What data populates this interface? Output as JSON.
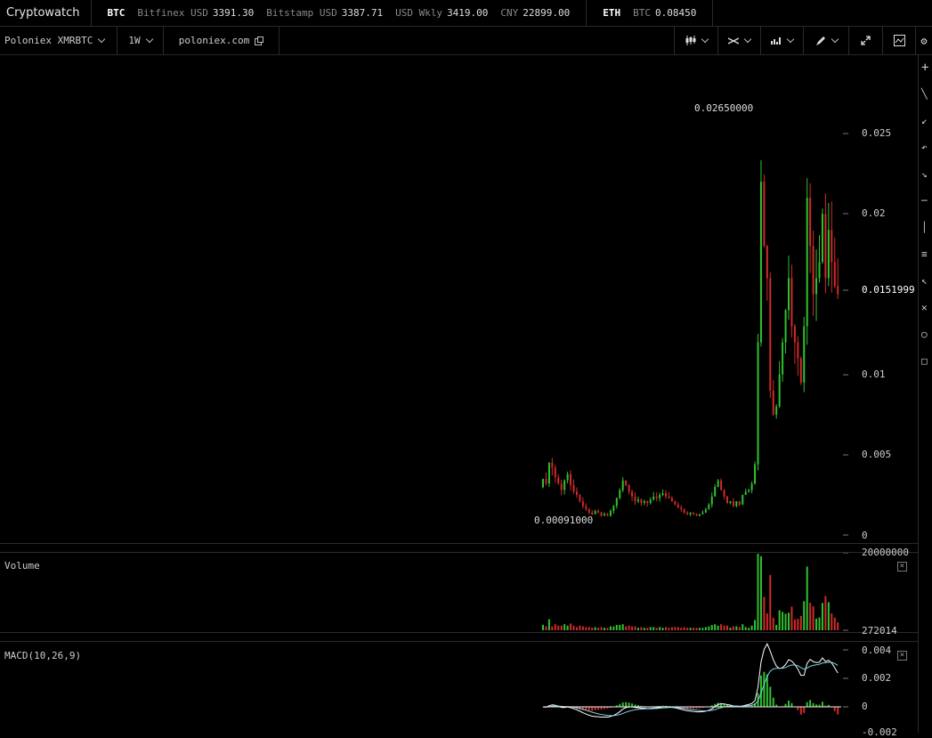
{
  "brand": "Cryptowatch",
  "tickers": [
    {
      "symbol": "BTC",
      "items": [
        {
          "label": "Bitfinex USD",
          "value": "3391.30"
        },
        {
          "label": "Bitstamp USD",
          "value": "3387.71"
        },
        {
          "label": "USD Wkly",
          "value": "3419.00"
        },
        {
          "label": "CNY",
          "value": "22899.00"
        }
      ]
    },
    {
      "symbol": "ETH",
      "items": [
        {
          "label": "BTC",
          "value": "0.08450"
        }
      ]
    }
  ],
  "toolbar": {
    "market": "Poloniex XMRBTC",
    "period": "1W",
    "exchange_link": "poloniex.com",
    "tools": [
      "candles-icon",
      "crosshair-icon",
      "indicators-icon",
      "draw-pencil-icon",
      "fullscreen-icon",
      "screenshot-icon",
      "settings-gear-icon"
    ]
  },
  "sidebar_tools": [
    "plus-icon",
    "line-icon",
    "ray-icon",
    "arc-icon",
    "arrow-icon",
    "horizontal-line-icon",
    "vertical-line-icon",
    "fib-lines-icon",
    "select-icon",
    "cross-icon",
    "circle-icon",
    "rect-icon"
  ],
  "price_axis": {
    "ticks": [
      "0.025",
      "0.02",
      "0.0151999",
      "0.01",
      "0.005",
      "0"
    ],
    "last_price": "0.0151999"
  },
  "annotations": {
    "high": "0.02650000",
    "low": "0.00091000"
  },
  "volume": {
    "label": "Volume",
    "max_tick": "20000000",
    "min_tick": "272014"
  },
  "macd": {
    "label": "MACD(10,26,9)",
    "ticks": [
      "0.004",
      "0.002",
      "0",
      "-0.002"
    ]
  },
  "colors": {
    "up": "#2fc12f",
    "down": "#d12a2a",
    "macd_line": "#ffffff",
    "signal_line": "#7fd1e8",
    "grid": "#2a2a2a"
  },
  "chart_data": {
    "type": "candlestick",
    "symbol": "XMRBTC",
    "interval": "1W",
    "ylim": [
      0,
      0.028
    ],
    "close": [
      0.0035,
      0.0032,
      0.0045,
      0.0042,
      0.0036,
      0.0032,
      0.0028,
      0.0034,
      0.0038,
      0.0031,
      0.0027,
      0.0025,
      0.0021,
      0.0018,
      0.0016,
      0.0014,
      0.0013,
      0.0015,
      0.0014,
      0.0012,
      0.0013,
      0.0012,
      0.0015,
      0.0018,
      0.0023,
      0.0028,
      0.0034,
      0.0031,
      0.0027,
      0.0024,
      0.0021,
      0.0022,
      0.002,
      0.0021,
      0.002,
      0.0022,
      0.0024,
      0.0023,
      0.0025,
      0.0026,
      0.0024,
      0.0023,
      0.0021,
      0.0019,
      0.0017,
      0.0016,
      0.0014,
      0.0013,
      0.0014,
      0.0013,
      0.0012,
      0.0013,
      0.0014,
      0.0016,
      0.0019,
      0.0024,
      0.003,
      0.0034,
      0.0028,
      0.0024,
      0.002,
      0.0021,
      0.0018,
      0.0021,
      0.0019,
      0.0025,
      0.0027,
      0.0028,
      0.0032,
      0.0044,
      0.012,
      0.022,
      0.018,
      0.016,
      0.009,
      0.0075,
      0.008,
      0.01,
      0.012,
      0.014,
      0.016,
      0.013,
      0.012,
      0.011,
      0.0095,
      0.013,
      0.021,
      0.018,
      0.015,
      0.016,
      0.017,
      0.02,
      0.016,
      0.019,
      0.017,
      0.0155,
      0.015
    ],
    "volume_max": 20000000,
    "volume_min": 272014
  }
}
